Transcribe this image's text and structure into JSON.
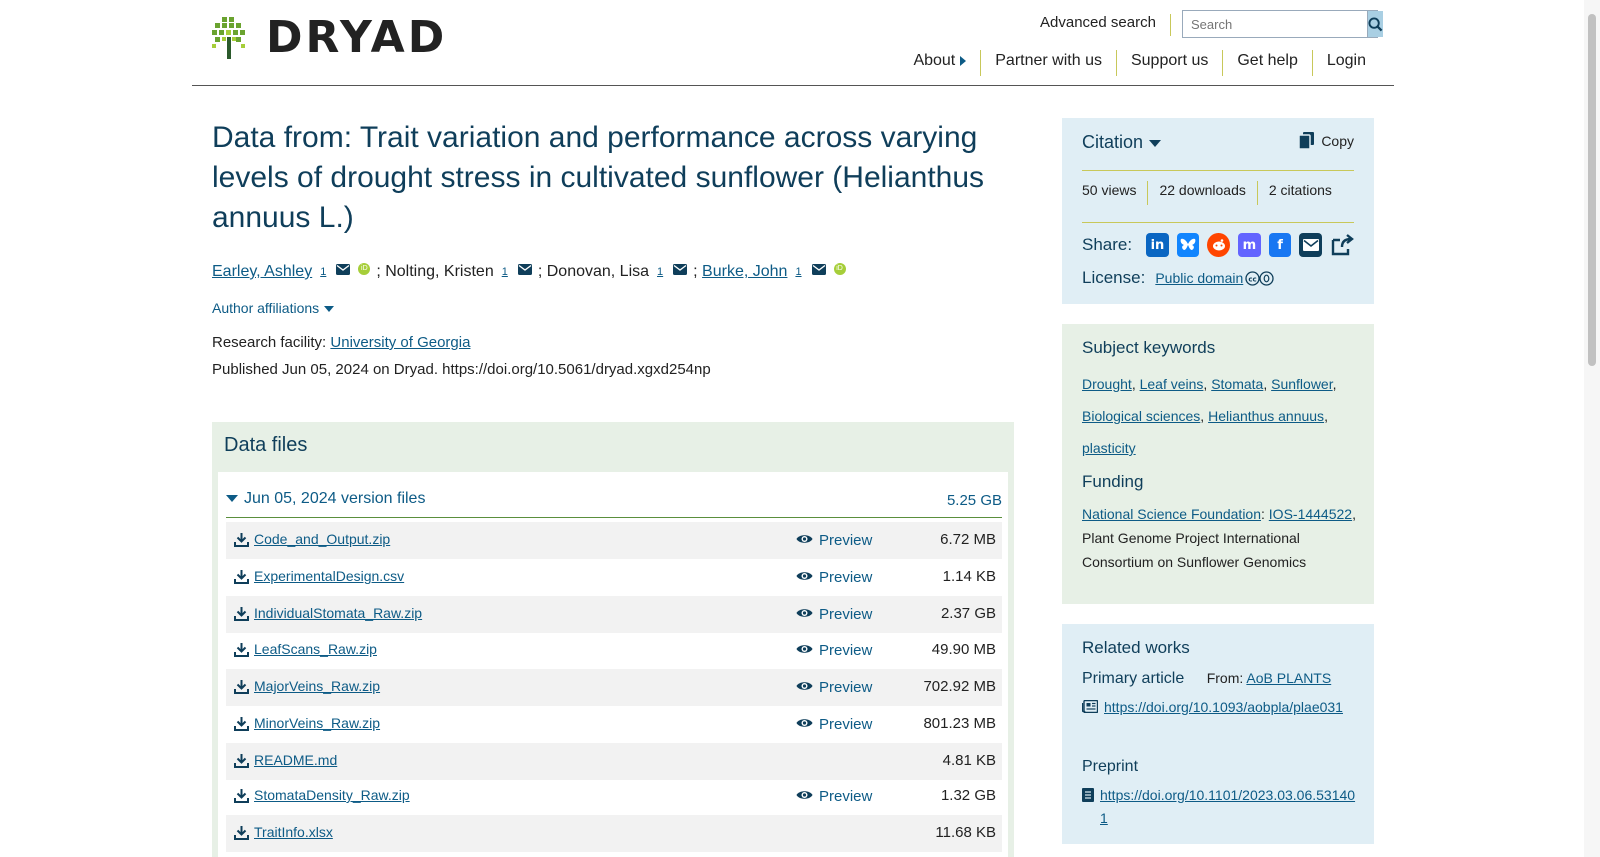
{
  "header": {
    "logo_text": "DRYAD",
    "advanced_search": "Advanced search",
    "search_placeholder": "Search",
    "nav": [
      "About",
      "Partner with us",
      "Support us",
      "Get help",
      "Login"
    ]
  },
  "dataset": {
    "title": "Data from: Trait variation and performance across varying levels of drought stress in cultivated sunflower (Helianthus annuus L.)",
    "authors": [
      {
        "name": "Earley, Ashley",
        "affil": "1",
        "linked": true,
        "orcid": true
      },
      {
        "name": "Nolting, Kristen",
        "affil": "1",
        "linked": false,
        "orcid": false
      },
      {
        "name": "Donovan, Lisa",
        "affil": "1",
        "linked": false,
        "orcid": false
      },
      {
        "name": "Burke, John",
        "affil": "1",
        "linked": true,
        "orcid": true
      }
    ],
    "author_affiliations": "Author affiliations",
    "facility_label": "Research facility:",
    "facility_value": "University of Georgia",
    "published": "Published Jun 05, 2024 on Dryad. https://doi.org/10.5061/dryad.xgxd254np"
  },
  "data_files": {
    "heading": "Data files",
    "version_label": "Jun 05, 2024 version files",
    "version_size": "5.25 GB",
    "preview_label": "Preview",
    "files": [
      {
        "name": "Code_and_Output.zip",
        "size": "6.72 MB",
        "preview": true
      },
      {
        "name": "ExperimentalDesign.csv",
        "size": "1.14 KB",
        "preview": true
      },
      {
        "name": "IndividualStomata_Raw.zip",
        "size": "2.37 GB",
        "preview": true
      },
      {
        "name": "LeafScans_Raw.zip",
        "size": "49.90 MB",
        "preview": true
      },
      {
        "name": "MajorVeins_Raw.zip",
        "size": "702.92 MB",
        "preview": true
      },
      {
        "name": "MinorVeins_Raw.zip",
        "size": "801.23 MB",
        "preview": true
      },
      {
        "name": "README.md",
        "size": "4.81 KB",
        "preview": false
      },
      {
        "name": "StomataDensity_Raw.zip",
        "size": "1.32 GB",
        "preview": true
      },
      {
        "name": "TraitInfo.xlsx",
        "size": "11.68 KB",
        "preview": false
      }
    ]
  },
  "sidebar": {
    "citation_label": "Citation",
    "copy_label": "Copy",
    "stats": [
      "50 views",
      "22 downloads",
      "2 citations"
    ],
    "share_label": "Share:",
    "license_label": "License:",
    "license_value": "Public domain",
    "keywords_heading": "Subject keywords",
    "keywords": [
      "Drought",
      "Leaf veins",
      "Stomata",
      "Sunflower",
      "Biological sciences",
      "Helianthus annuus",
      "plasticity"
    ],
    "funding_heading": "Funding",
    "funding_org": "National Science Foundation",
    "funding_grant": "IOS-1444522",
    "funding_rest": ", Plant Genome Project International Consortium on Sunflower Genomics",
    "related_heading": "Related works",
    "primary_label": "Primary article",
    "primary_from": "From:",
    "primary_journal": "AoB PLANTS",
    "primary_doi": "https://doi.org/10.1093/aobpla/plae031",
    "preprint_label": "Preprint",
    "preprint_doi": "https://doi.org/10.1101/2023.03.06.531401"
  }
}
